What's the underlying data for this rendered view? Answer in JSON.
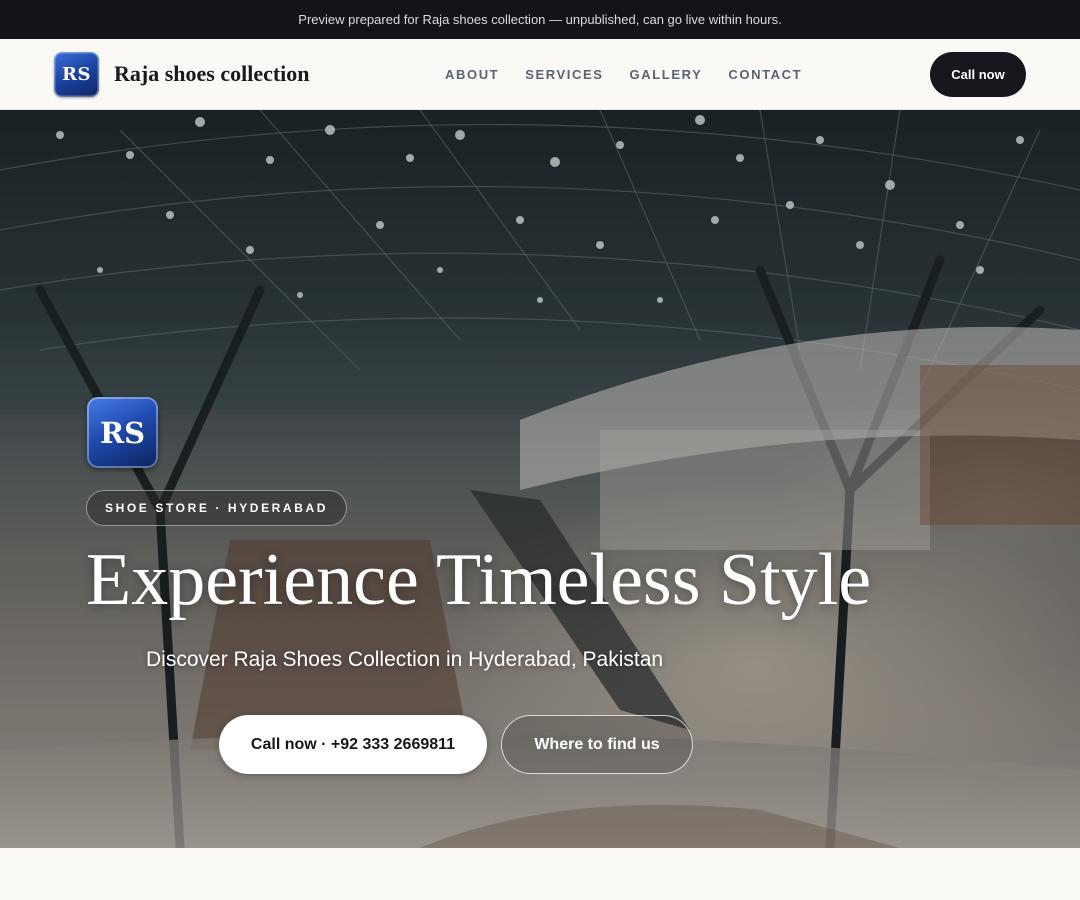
{
  "announcement": {
    "text": "Preview prepared for Raja shoes collection — unpublished, can go live within hours."
  },
  "header": {
    "logo_text": "RS",
    "brand_name": "Raja shoes collection",
    "nav": [
      {
        "label": "ABOUT"
      },
      {
        "label": "SERVICES"
      },
      {
        "label": "GALLERY"
      },
      {
        "label": "CONTACT"
      }
    ],
    "cta_label": "Call now"
  },
  "hero": {
    "logo_text": "RS",
    "tag": "SHOE STORE · HYDERABAD",
    "title": "Experience Timeless Style",
    "subtitle": "Discover Raja Shoes Collection in Hyderabad, Pakistan",
    "primary_button": "Call now · +92 333 2669811",
    "secondary_button": "Where to find us",
    "background_image": "shopping-mall-interior"
  },
  "colors": {
    "announcement_bg": "#121419",
    "header_bg": "#faf9f6",
    "dark_button": "#16181d",
    "logo_blue": "#1c46a6",
    "nav_text": "#5b6270"
  }
}
